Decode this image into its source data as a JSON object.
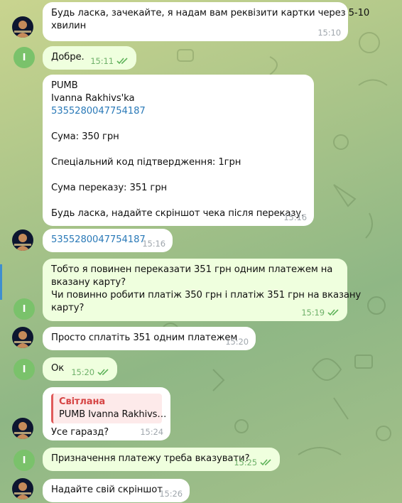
{
  "avatars": {
    "me_initial": "I"
  },
  "messages": [
    {
      "id": "m1",
      "lines": [
        "Будь ласка, зачекайте, я надам вам реквізити картки через 5-10",
        "хвилин"
      ],
      "time": "15:10"
    },
    {
      "id": "m2",
      "lines": [
        "Добре."
      ],
      "time": "15:11"
    },
    {
      "id": "m3",
      "lines": [
        "PUMB",
        "Ivanna Rakhivs'ka",
        "5355280047754187",
        "",
        "Сума: 350 грн",
        "",
        "Спеціальний код підтвердження: 1грн",
        "",
        "Сума переказу: 351 грн",
        "",
        "Будь ласка, надайте скріншот чека після переказу."
      ],
      "time": "15:16"
    },
    {
      "id": "m4",
      "lines": [
        "5355280047754187"
      ],
      "time": "15:16"
    },
    {
      "id": "m5",
      "lines": [
        "Тобто я повинен переказати 351 грн одним платежем на",
        "вказану карту?",
        "Чи повинно робити платіж 350 грн і платіж 351 грн на вказану",
        "карту?"
      ],
      "time": "15:19"
    },
    {
      "id": "m6",
      "lines": [
        "Просто сплатіть 351 одним платежем"
      ],
      "time": "15:20"
    },
    {
      "id": "m7",
      "lines": [
        "Ок"
      ],
      "time": "15:20"
    },
    {
      "id": "m8",
      "reply_name": "Світлана",
      "reply_text": "PUMB Ivanna Rakhivs…",
      "lines": [
        "Усе гаразд?"
      ],
      "time": "15:24"
    },
    {
      "id": "m9",
      "lines": [
        "Призначення платежу треба вказувати?"
      ],
      "time": "15:25"
    },
    {
      "id": "m10",
      "lines": [
        "Надайте свій скріншот"
      ],
      "time": "15:26"
    }
  ]
}
